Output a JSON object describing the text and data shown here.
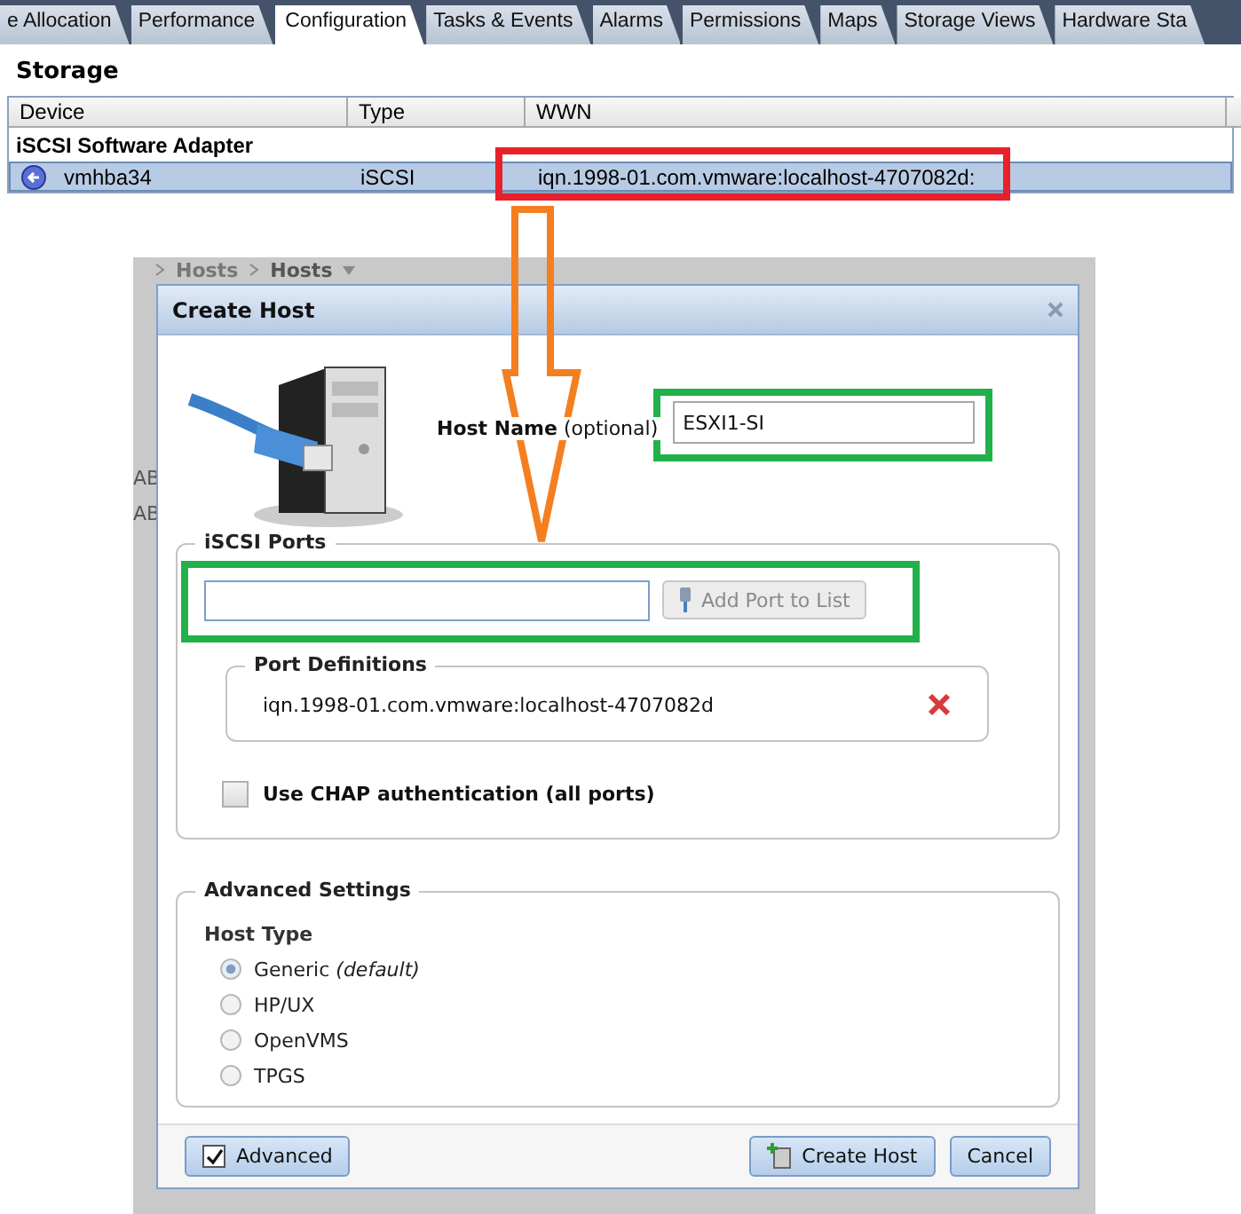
{
  "tabs": [
    {
      "label": "e Allocation",
      "selected": false
    },
    {
      "label": "Performance",
      "selected": false
    },
    {
      "label": "Configuration",
      "selected": true
    },
    {
      "label": "Tasks & Events",
      "selected": false
    },
    {
      "label": "Alarms",
      "selected": false
    },
    {
      "label": "Permissions",
      "selected": false
    },
    {
      "label": "Maps",
      "selected": false
    },
    {
      "label": "Storage Views",
      "selected": false
    },
    {
      "label": "Hardware Sta",
      "selected": false
    }
  ],
  "storage": {
    "title": "Storage",
    "columns": [
      "Device",
      "Type",
      "WWN"
    ],
    "group": "iSCSI Software Adapter",
    "rows": [
      {
        "device": "vmhba34",
        "type": "iSCSI",
        "wwn": "iqn.1998-01.com.vmware:localhost-4707082d:",
        "selected": true
      }
    ]
  },
  "background": {
    "breadcrumb": [
      "Hosts",
      "Hosts"
    ],
    "fragments": [
      "AB",
      "AB"
    ]
  },
  "dialog": {
    "title": "Create Host",
    "host_name": {
      "label": "**Host Name** (optional)",
      "value": "ESXI1-SI"
    },
    "iscsi_ports": {
      "title": "iSCSI Ports",
      "add_button": {
        "label": "Add Port to List",
        "disabled": true
      },
      "port_definitions": {
        "title": "Port Definitions",
        "items": [
          "iqn.1998-01.com.vmware:localhost-4707082d"
        ]
      },
      "chap": {
        "label": "Use CHAP authentication (all ports)",
        "checked": false
      }
    },
    "advanced_settings": {
      "title": "Advanced Settings",
      "host_type_label": "Host Type",
      "options": [
        {
          "label": "Generic *(default)*",
          "selected": true
        },
        {
          "label": "HP/UX",
          "selected": false
        },
        {
          "label": "OpenVMS",
          "selected": false
        },
        {
          "label": "TPGS",
          "selected": false
        }
      ]
    },
    "footer": {
      "advanced": {
        "label": "Advanced",
        "checked": true
      },
      "create": "Create Host",
      "cancel": "Cancel"
    }
  },
  "annotations": [
    {
      "kind": "box",
      "color": "#e8202a"
    },
    {
      "kind": "arrow",
      "color": "#f47f20"
    },
    {
      "kind": "box",
      "color": "#21b14b"
    },
    {
      "kind": "box",
      "color": "#21b14b"
    }
  ]
}
